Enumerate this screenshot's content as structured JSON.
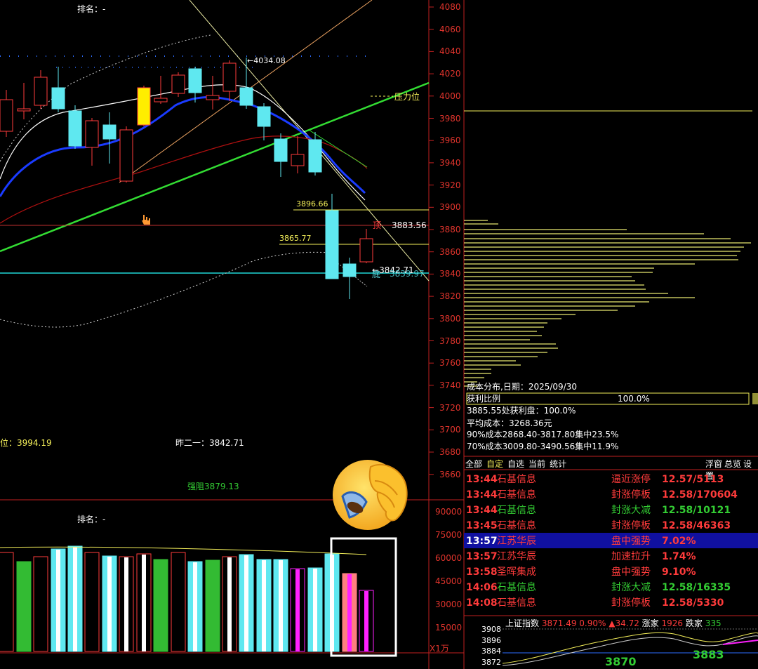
{
  "kline_panel": {
    "rank_label": "排名：-",
    "price_axis": [
      "4080",
      "4060",
      "4040",
      "4020",
      "4000",
      "3980",
      "3960",
      "3940",
      "3920",
      "3900",
      "3880",
      "3860",
      "3840",
      "3820",
      "3800",
      "3780",
      "3760",
      "3740",
      "3720",
      "3700",
      "3680",
      "3660"
    ],
    "annotations": {
      "high_value": "4034.08",
      "pressure_label": "压力位",
      "level_1": "3896.66",
      "level_2": "3865.77",
      "top_label": "顶",
      "top_value": "3883.56",
      "low_value": "3842.71",
      "bottom_label": "底",
      "bottom_value": "3839.97"
    },
    "footer": {
      "left_value": "位：3994.19",
      "prev_close": "昨二一：3842.71",
      "resistance": "强阻3879.13"
    }
  },
  "volume_panel": {
    "rank_label": "排名：-",
    "axis": [
      "90000",
      "75000",
      "60000",
      "45000",
      "30000",
      "15000"
    ],
    "unit": "X1万"
  },
  "cost_distribution": {
    "date_line": "成本分布,日期：2025/09/30",
    "profit_ratio_label": "获利比例",
    "profit_ratio_value": "100.0%",
    "profit_line": "3885.55处获利盘：100.0%",
    "avg_cost": "平均成本：3268.36元",
    "cost_90": "90%成本2868.40-3817.80集中23.5%",
    "cost_70": "70%成本3009.80-3490.56集中11.9%"
  },
  "alerts": {
    "tabs": [
      "全部",
      "自定",
      "自选",
      "当前",
      "统计"
    ],
    "right_tabs": [
      "浮窗",
      "总览",
      "设置"
    ],
    "rows": [
      {
        "time": "13:44",
        "name": "石基信息",
        "event": "逼近涨停",
        "value": "12.57/5113",
        "color": "red"
      },
      {
        "time": "13:44",
        "name": "石基信息",
        "event": "封涨停板",
        "value": "12.58/170604",
        "color": "red"
      },
      {
        "time": "13:44",
        "name": "石基信息",
        "event": "封涨大减",
        "value": "12.58/10121",
        "color": "green"
      },
      {
        "time": "13:45",
        "name": "石基信息",
        "event": "封涨停板",
        "value": "12.58/46363",
        "color": "red"
      },
      {
        "time": "13:57",
        "name": "江苏华辰",
        "event": "盘中强势",
        "value": "7.02%",
        "color": "red",
        "selected": true
      },
      {
        "time": "13:57",
        "name": "江苏华辰",
        "event": "加速拉升",
        "value": "1.74%",
        "color": "red"
      },
      {
        "time": "13:58",
        "name": "圣晖集成",
        "event": "盘中强势",
        "value": "9.10%",
        "color": "red"
      },
      {
        "time": "14:06",
        "name": "石基信息",
        "event": "封涨大减",
        "value": "12.58/16335",
        "color": "green"
      },
      {
        "time": "14:08",
        "name": "石基信息",
        "event": "封涨停板",
        "value": "12.58/5330",
        "color": "red"
      }
    ]
  },
  "index_mini": {
    "name": "上证指数",
    "price": "3871.49",
    "pct": "0.90%",
    "change": "▲34.72",
    "up_label": "涨家",
    "up_count": "1926",
    "down_label": "跌家",
    "down_count": "335",
    "axis": [
      "3908",
      "3896",
      "3884",
      "3872"
    ],
    "big_left": "3870",
    "big_right": "3883"
  },
  "colors": {
    "axis_red": "#e0342c",
    "cyan": "#5fe8f0",
    "yellow": "#f5f05a",
    "green": "#33cc33",
    "blue_ma": "#1a3bff",
    "red_ma": "#b01010",
    "magenta": "#ff20ff",
    "salmon": "#ff7f7f"
  },
  "icons": {
    "emoji": "face-palm-emoji",
    "cursor": "hand-pointer-icon"
  }
}
